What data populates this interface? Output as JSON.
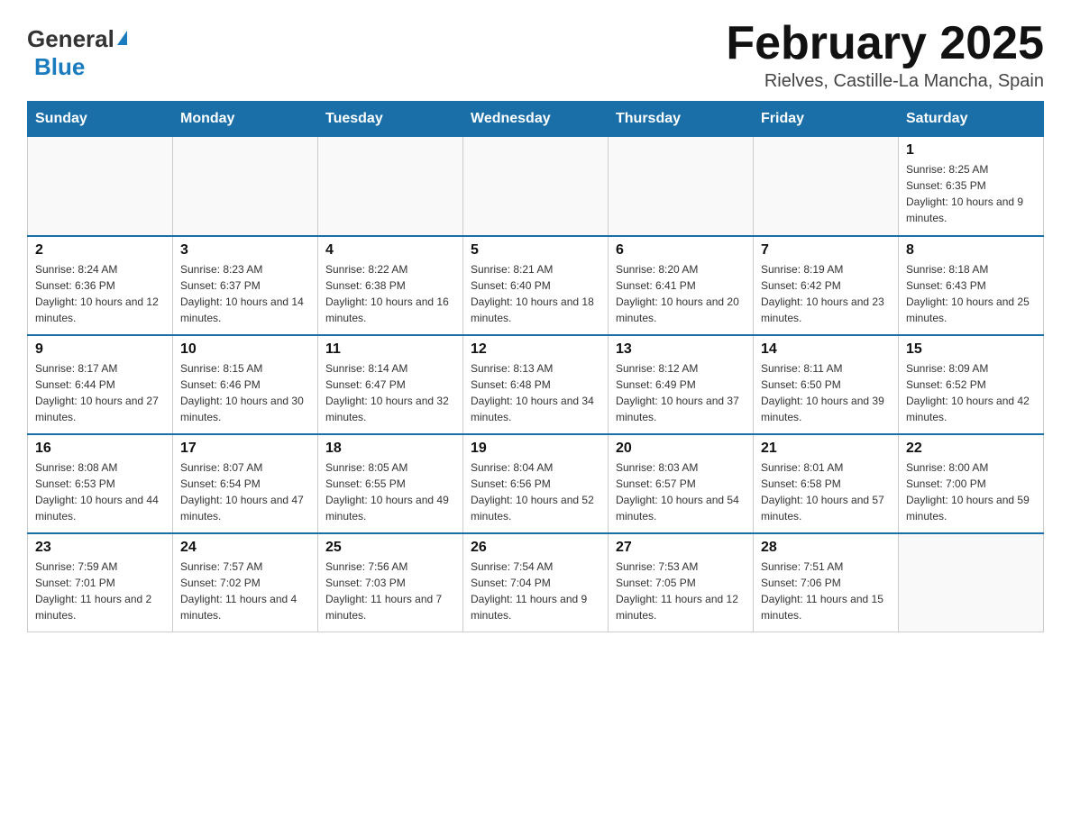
{
  "header": {
    "logo_general": "General",
    "logo_blue": "Blue",
    "month_title": "February 2025",
    "location": "Rielves, Castille-La Mancha, Spain"
  },
  "weekdays": [
    "Sunday",
    "Monday",
    "Tuesday",
    "Wednesday",
    "Thursday",
    "Friday",
    "Saturday"
  ],
  "weeks": [
    [
      {
        "day": "",
        "info": ""
      },
      {
        "day": "",
        "info": ""
      },
      {
        "day": "",
        "info": ""
      },
      {
        "day": "",
        "info": ""
      },
      {
        "day": "",
        "info": ""
      },
      {
        "day": "",
        "info": ""
      },
      {
        "day": "1",
        "info": "Sunrise: 8:25 AM\nSunset: 6:35 PM\nDaylight: 10 hours and 9 minutes."
      }
    ],
    [
      {
        "day": "2",
        "info": "Sunrise: 8:24 AM\nSunset: 6:36 PM\nDaylight: 10 hours and 12 minutes."
      },
      {
        "day": "3",
        "info": "Sunrise: 8:23 AM\nSunset: 6:37 PM\nDaylight: 10 hours and 14 minutes."
      },
      {
        "day": "4",
        "info": "Sunrise: 8:22 AM\nSunset: 6:38 PM\nDaylight: 10 hours and 16 minutes."
      },
      {
        "day": "5",
        "info": "Sunrise: 8:21 AM\nSunset: 6:40 PM\nDaylight: 10 hours and 18 minutes."
      },
      {
        "day": "6",
        "info": "Sunrise: 8:20 AM\nSunset: 6:41 PM\nDaylight: 10 hours and 20 minutes."
      },
      {
        "day": "7",
        "info": "Sunrise: 8:19 AM\nSunset: 6:42 PM\nDaylight: 10 hours and 23 minutes."
      },
      {
        "day": "8",
        "info": "Sunrise: 8:18 AM\nSunset: 6:43 PM\nDaylight: 10 hours and 25 minutes."
      }
    ],
    [
      {
        "day": "9",
        "info": "Sunrise: 8:17 AM\nSunset: 6:44 PM\nDaylight: 10 hours and 27 minutes."
      },
      {
        "day": "10",
        "info": "Sunrise: 8:15 AM\nSunset: 6:46 PM\nDaylight: 10 hours and 30 minutes."
      },
      {
        "day": "11",
        "info": "Sunrise: 8:14 AM\nSunset: 6:47 PM\nDaylight: 10 hours and 32 minutes."
      },
      {
        "day": "12",
        "info": "Sunrise: 8:13 AM\nSunset: 6:48 PM\nDaylight: 10 hours and 34 minutes."
      },
      {
        "day": "13",
        "info": "Sunrise: 8:12 AM\nSunset: 6:49 PM\nDaylight: 10 hours and 37 minutes."
      },
      {
        "day": "14",
        "info": "Sunrise: 8:11 AM\nSunset: 6:50 PM\nDaylight: 10 hours and 39 minutes."
      },
      {
        "day": "15",
        "info": "Sunrise: 8:09 AM\nSunset: 6:52 PM\nDaylight: 10 hours and 42 minutes."
      }
    ],
    [
      {
        "day": "16",
        "info": "Sunrise: 8:08 AM\nSunset: 6:53 PM\nDaylight: 10 hours and 44 minutes."
      },
      {
        "day": "17",
        "info": "Sunrise: 8:07 AM\nSunset: 6:54 PM\nDaylight: 10 hours and 47 minutes."
      },
      {
        "day": "18",
        "info": "Sunrise: 8:05 AM\nSunset: 6:55 PM\nDaylight: 10 hours and 49 minutes."
      },
      {
        "day": "19",
        "info": "Sunrise: 8:04 AM\nSunset: 6:56 PM\nDaylight: 10 hours and 52 minutes."
      },
      {
        "day": "20",
        "info": "Sunrise: 8:03 AM\nSunset: 6:57 PM\nDaylight: 10 hours and 54 minutes."
      },
      {
        "day": "21",
        "info": "Sunrise: 8:01 AM\nSunset: 6:58 PM\nDaylight: 10 hours and 57 minutes."
      },
      {
        "day": "22",
        "info": "Sunrise: 8:00 AM\nSunset: 7:00 PM\nDaylight: 10 hours and 59 minutes."
      }
    ],
    [
      {
        "day": "23",
        "info": "Sunrise: 7:59 AM\nSunset: 7:01 PM\nDaylight: 11 hours and 2 minutes."
      },
      {
        "day": "24",
        "info": "Sunrise: 7:57 AM\nSunset: 7:02 PM\nDaylight: 11 hours and 4 minutes."
      },
      {
        "day": "25",
        "info": "Sunrise: 7:56 AM\nSunset: 7:03 PM\nDaylight: 11 hours and 7 minutes."
      },
      {
        "day": "26",
        "info": "Sunrise: 7:54 AM\nSunset: 7:04 PM\nDaylight: 11 hours and 9 minutes."
      },
      {
        "day": "27",
        "info": "Sunrise: 7:53 AM\nSunset: 7:05 PM\nDaylight: 11 hours and 12 minutes."
      },
      {
        "day": "28",
        "info": "Sunrise: 7:51 AM\nSunset: 7:06 PM\nDaylight: 11 hours and 15 minutes."
      },
      {
        "day": "",
        "info": ""
      }
    ]
  ]
}
